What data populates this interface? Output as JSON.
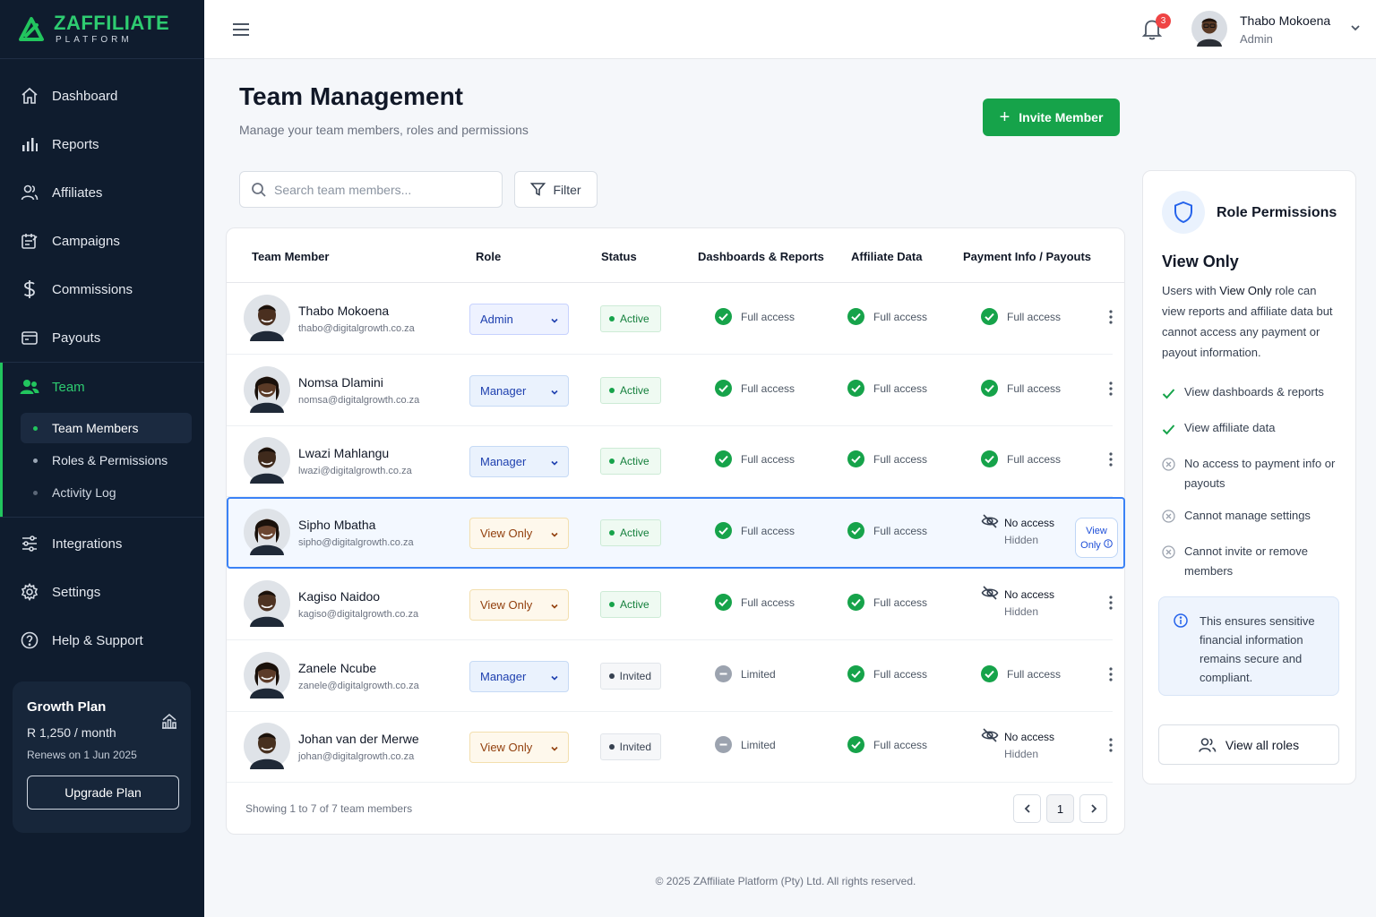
{
  "brand": {
    "name": "ZAFFILIATE",
    "sub": "PLATFORM"
  },
  "sidebar": {
    "items": [
      {
        "label": "Dashboard",
        "icon": "home-icon"
      },
      {
        "label": "Reports",
        "icon": "bar-chart-icon"
      },
      {
        "label": "Affiliates",
        "icon": "users-icon"
      },
      {
        "label": "Campaigns",
        "icon": "campaign-icon"
      },
      {
        "label": "Commissions",
        "icon": "dollar-icon"
      },
      {
        "label": "Payouts",
        "icon": "wallet-icon"
      }
    ],
    "team": {
      "label": "Team",
      "icon": "team-icon"
    },
    "sub_items": [
      {
        "label": "Team Members"
      },
      {
        "label": "Roles & Permissions"
      },
      {
        "label": "Activity Log"
      }
    ],
    "bottom_items": [
      {
        "label": "Integrations",
        "icon": "sliders-icon"
      },
      {
        "label": "Settings",
        "icon": "gear-icon"
      },
      {
        "label": "Help & Support",
        "icon": "help-icon"
      }
    ],
    "plan": {
      "title": "Growth Plan",
      "price": "R 1,250 / month",
      "renews": "Renews on 1 Jun 2025",
      "button": "Upgrade Plan"
    }
  },
  "topbar": {
    "notifications": "3",
    "user_name": "Thabo Mokoena",
    "user_role": "Admin"
  },
  "header": {
    "title": "Team Management",
    "subtitle": "Manage your team members, roles and permissions",
    "invite_label": "Invite Member"
  },
  "search": {
    "placeholder": "Search team members...",
    "value": ""
  },
  "filter_label": "Filter",
  "table": {
    "columns": [
      "Team Member",
      "Role",
      "Status",
      "Dashboards & Reports",
      "Affiliate Data",
      "Payment Info / Payouts"
    ],
    "rows": [
      {
        "name": "Thabo Mokoena",
        "email": "thabo@digitalgrowth.co.za",
        "role": "Admin",
        "status": "Active",
        "dashboards": "Full access",
        "affiliate": "Full access",
        "payment": "Full access"
      },
      {
        "name": "Nomsa Dlamini",
        "email": "nomsa@digitalgrowth.co.za",
        "role": "Manager",
        "status": "Active",
        "dashboards": "Full access",
        "affiliate": "Full access",
        "payment": "Full access"
      },
      {
        "name": "Lwazi Mahlangu",
        "email": "lwazi@digitalgrowth.co.za",
        "role": "Manager",
        "status": "Active",
        "dashboards": "Full access",
        "affiliate": "Full access",
        "payment": "Full access"
      },
      {
        "name": "Sipho Mbatha",
        "email": "sipho@digitalgrowth.co.za",
        "role": "View Only",
        "status": "Active",
        "dashboards": "Full access",
        "affiliate": "Full access",
        "payment": "No access",
        "payment_sub": "Hidden",
        "tip_line1": "View",
        "tip_line2": "Only"
      },
      {
        "name": "Kagiso Naidoo",
        "email": "kagiso@digitalgrowth.co.za",
        "role": "View Only",
        "status": "Active",
        "dashboards": "Full access",
        "affiliate": "Full access",
        "payment": "No access",
        "payment_sub": "Hidden"
      },
      {
        "name": "Zanele Ncube",
        "email": "zanele@digitalgrowth.co.za",
        "role": "Manager",
        "status": "Invited",
        "dashboards": "Limited",
        "affiliate": "Full access",
        "payment": "Full access"
      },
      {
        "name": "Johan van der Merwe",
        "email": "johan@digitalgrowth.co.za",
        "role": "View Only",
        "status": "Invited",
        "dashboards": "Limited",
        "affiliate": "Full access",
        "payment": "No access",
        "payment_sub": "Hidden"
      }
    ],
    "footer": "Showing 1 to 7 of 7 team members",
    "page": "1"
  },
  "permissions": {
    "title": "Role Permissions",
    "role": "View Only",
    "description_pre": "Users with ",
    "description_role": "View Only",
    "description_post": " role can view reports and affiliate data but cannot access any payment or payout information.",
    "items": [
      {
        "label": "View dashboards & reports",
        "allowed": true
      },
      {
        "label": "View affiliate data",
        "allowed": true
      },
      {
        "label": "No access to payment info or payouts",
        "allowed": false
      },
      {
        "label": "Cannot manage settings",
        "allowed": false
      },
      {
        "label": "Cannot invite or remove members",
        "allowed": false
      }
    ],
    "note": "This ensures sensitive financial information remains secure and compliant.",
    "button": "View all roles"
  },
  "footer": "© 2025 ZAffiliate Platform (Pty) Ltd. All rights reserved.",
  "colors": {
    "accent": "#16a34a",
    "sidebar_bg": "#0f1c2e",
    "highlight": "#3b82f6"
  }
}
